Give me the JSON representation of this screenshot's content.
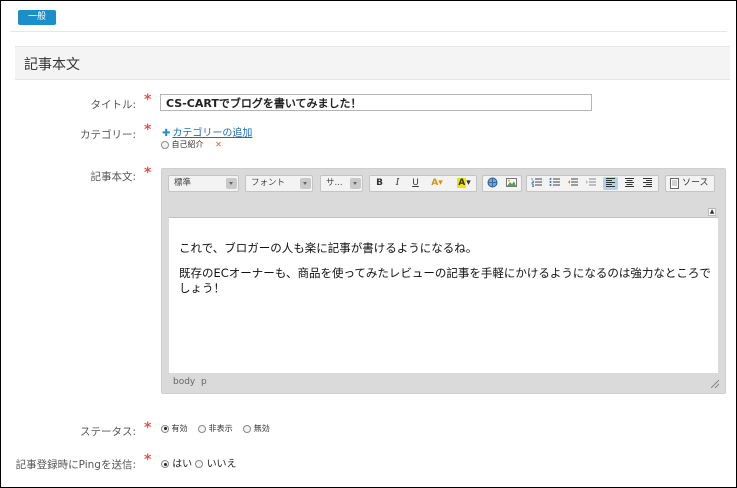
{
  "tabs": {
    "general": "一般"
  },
  "section": {
    "title": "記事本文"
  },
  "form": {
    "title_label": "タイトル:",
    "title_value": "CS-CARTでブログを書いてみました！",
    "category_label": "カテゴリー:",
    "category_add": "カテゴリーの追加",
    "category_item": "自己紹介",
    "body_label": "記事本文:",
    "status_label": "ステータス:",
    "status_options": [
      "有効",
      "非表示",
      "無効"
    ],
    "status_selected": "有効",
    "ping_label": "記事登録時にPingを送信:",
    "ping_options": [
      "はい",
      "いいえ"
    ],
    "ping_selected": "はい",
    "required_mark": "*"
  },
  "editor": {
    "format_combo": "標準",
    "font_combo": "フォント",
    "size_combo": "サ...",
    "source_label": "ソース",
    "paragraph1": "これで、ブロガーの人も楽に記事が書けるようになるね。",
    "paragraph2": "既存のECオーナーも、商品を使ってみたレビューの記事を手軽にかけるようになるのは強力なところでしょう！",
    "path_body": "body",
    "path_p": "p"
  },
  "icons": {
    "bold": "B",
    "italic": "I",
    "underline": "U",
    "text_color": "A",
    "bg_color": "A"
  },
  "colors": {
    "accent": "#1a8fc9",
    "required": "#d9534f"
  }
}
